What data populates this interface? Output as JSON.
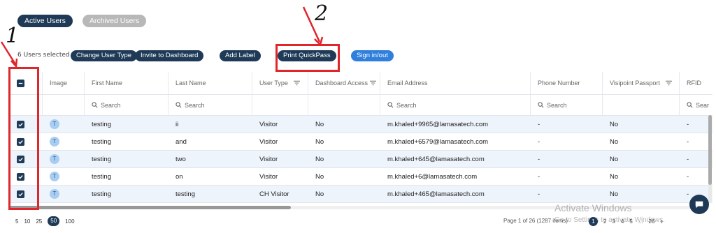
{
  "tabs": [
    {
      "label": "Active Users",
      "active": true
    },
    {
      "label": "Archived Users",
      "active": false
    }
  ],
  "toolbar": {
    "selected_text": "6 Users selected",
    "buttons": [
      "Change User Type",
      "Invite to Dashboard",
      "Add Label",
      "Print QuickPass",
      "Sign in/out"
    ]
  },
  "annotations": {
    "one": "1",
    "two": "2"
  },
  "columns": [
    "Image",
    "First Name",
    "Last Name",
    "User Type",
    "Dashboard Access",
    "Email Address",
    "Phone Number",
    "Visipoint Passport",
    "RFID"
  ],
  "search_placeholder": "Search",
  "search_partial": "Sear",
  "rows": [
    {
      "avatar": "T",
      "first": "testing",
      "last": "ii",
      "type": "Visitor",
      "dash": "No",
      "email": "m.khaled+9965@lamasatech.com",
      "phone": "-",
      "passport": "No",
      "rfid": "-"
    },
    {
      "avatar": "T",
      "first": "testing",
      "last": "and",
      "type": "Visitor",
      "dash": "No",
      "email": "m.khaled+6579@lamasatech.com",
      "phone": "-",
      "passport": "No",
      "rfid": "-"
    },
    {
      "avatar": "T",
      "first": "testing",
      "last": "two",
      "type": "Visitor",
      "dash": "No",
      "email": "m.khaled+645@lamasatech.com",
      "phone": "-",
      "passport": "No",
      "rfid": "-"
    },
    {
      "avatar": "T",
      "first": "testing",
      "last": "on",
      "type": "Visitor",
      "dash": "No",
      "email": "m.khaled+6@lamasatech.com",
      "phone": "-",
      "passport": "No",
      "rfid": "-"
    },
    {
      "avatar": "T",
      "first": "testing",
      "last": "testing",
      "type": "CH Visitor",
      "dash": "No",
      "email": "m.khaled+465@lamasatech.com",
      "phone": "-",
      "passport": "No",
      "rfid": "-"
    }
  ],
  "page_sizes": [
    "5",
    "10",
    "25",
    "50",
    "100"
  ],
  "page_size_selected": "50",
  "pager_text": "Page 1 of 26 (1287 items)",
  "page_nav": {
    "current": "1",
    "pages": [
      "2",
      "3",
      "4",
      "5"
    ],
    "ellipsis": "...",
    "last": "26",
    "next": "›"
  },
  "watermark": {
    "line1": "Activate Windows",
    "line2": "Go to Settings to activate Windows."
  },
  "colors": {
    "primary": "#1f3a57",
    "accent": "#2f7fdc",
    "annotation": "#e0252b",
    "row_alt": "#eef4fb"
  }
}
